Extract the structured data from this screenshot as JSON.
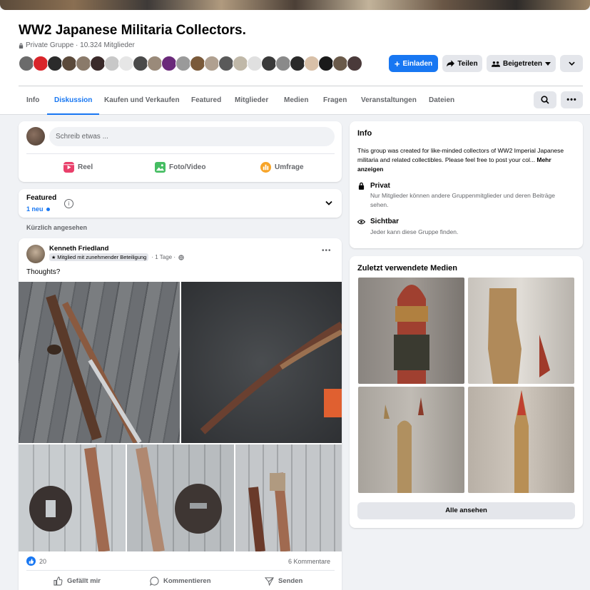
{
  "group": {
    "title": "WW2 Japanese Militaria Collectors.",
    "meta": "Private Gruppe · 10.324 Mitglieder"
  },
  "buttons": {
    "invite": "Einladen",
    "share": "Teilen",
    "joined": "Beigetreten"
  },
  "tabs": [
    "Info",
    "Diskussion",
    "Kaufen und Verkaufen",
    "Featured",
    "Mitglieder",
    "Medien",
    "Fragen",
    "Veranstaltungen",
    "Dateien"
  ],
  "composer": {
    "placeholder": "Schreib etwas ...",
    "reel": "Reel",
    "photo": "Foto/Video",
    "poll": "Umfrage"
  },
  "featured": {
    "title": "Featured",
    "new_count": "1 neu"
  },
  "feed_label": "Kürzlich angesehen",
  "post": {
    "author": "Kenneth Friedland",
    "badge": "Mitglied mit zunehmender Beteiligung",
    "time": "· 1 Tage ·",
    "text": "Thoughts?",
    "reactions": "20",
    "comments": "6 Kommentare",
    "like": "Gefällt mir",
    "comment": "Kommentieren",
    "send": "Senden"
  },
  "info": {
    "heading": "Info",
    "description": "This group was created for like-minded collectors of WW2 Imperial Japanese militaria and related collectibles. Please feel free to post your col...",
    "more": "Mehr anzeigen",
    "private_title": "Privat",
    "private_desc": "Nur Mitglieder können andere Gruppenmitglieder und deren Beiträge sehen.",
    "visible_title": "Sichtbar",
    "visible_desc": "Jeder kann diese Gruppe finden."
  },
  "media": {
    "heading": "Zuletzt verwendete Medien",
    "see_all": "Alle ansehen"
  },
  "colors": {
    "accent": "#1877f2",
    "background": "#f0f2f5"
  }
}
